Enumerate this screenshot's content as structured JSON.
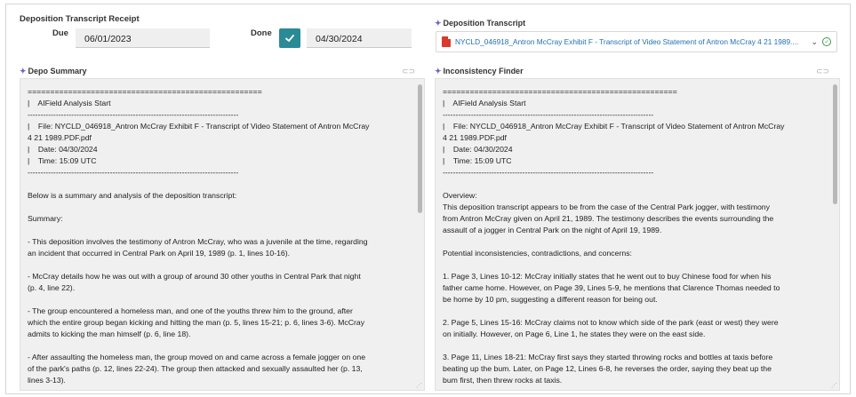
{
  "receipt": {
    "title": "Deposition Transcript Receipt",
    "due_label": "Due",
    "due_value": "06/01/2023",
    "done_label": "Done",
    "done_value": "04/30/2024"
  },
  "transcript_field": {
    "label": "Deposition Transcript",
    "file_link": "NYCLD_046918_Antron McCray Exhibit F - Transcript of Video Statement of Antron McCray 4 21 1989...."
  },
  "depo_summary": {
    "label": "Depo Summary",
    "text": "====================================================\n|    AIField Analysis Start\n----------------------------------------------------------------------------------\n|    File: NYCLD_046918_Antron McCray Exhibit F - Transcript of Video Statement of Antron McCray\n4 21 1989.PDF.pdf\n|    Date: 04/30/2024\n|    Time: 15:09 UTC\n----------------------------------------------------------------------------------\n\nBelow is a summary and analysis of the deposition transcript:\n\nSummary:\n\n- This deposition involves the testimony of Antron McCray, who was a juvenile at the time, regarding\nan incident that occurred in Central Park on April 19, 1989 (p. 1, lines 10-16).\n\n- McCray details how he was out with a group of around 30 other youths in Central Park that night\n(p. 4, line 22).\n\n- The group encountered a homeless man, and one of the youths threw him to the ground, after\nwhich the entire group began kicking and hitting the man (p. 5, lines 15-21; p. 6, lines 3-6). McCray\nadmits to kicking the man himself (p. 6, line 18).\n\n- After assaulting the homeless man, the group moved on and came across a female jogger on one\nof the park's paths (p. 12, lines 22-24). The group then attacked and sexually assaulted her (p. 13,\nlines 3-13)."
  },
  "inconsistency_finder": {
    "label": "Inconsistency Finder",
    "text": "====================================================\n|    AIField Analysis Start\n----------------------------------------------------------------------------------\n|    File: NYCLD_046918_Antron McCray Exhibit F - Transcript of Video Statement of Antron McCray\n4 21 1989.PDF.pdf\n|    Date: 04/30/2024\n|    Time: 15:09 UTC\n----------------------------------------------------------------------------------\n\nOverview:\nThis deposition transcript appears to be from the case of the Central Park jogger, with testimony\nfrom Antron McCray given on April 21, 1989. The testimony describes the events surrounding the\nassault of a jogger in Central Park on the night of April 19, 1989.\n\nPotential inconsistencies, contradictions, and concerns:\n\n1. Page 3, Lines 10-12: McCray initially states that he went out to buy Chinese food for when his\nfather came home. However, on Page 39, Lines 5-9, he mentions that Clarence Thomas needed to\nbe home by 10 pm, suggesting a different reason for being out.\n\n2. Page 5, Lines 15-16: McCray claims not to know which side of the park (east or west) they were\non initially. However, on Page 6, Line 1, he states they were on the east side.\n\n3. Page 11, Lines 18-21: McCray first says they started throwing rocks and bottles at taxis before\nbeating up the bum. Later, on Page 12, Lines 6-8, he reverses the order, saying they beat up the\nbum first, then threw rocks at taxis."
  },
  "colors": {
    "accent": "#2a8a96",
    "link": "#1f6fb5",
    "pdf": "#d93a2b",
    "ok": "#3a9a4a",
    "sparkle": "#7b5cd6"
  },
  "icons": [
    "sparkle-icon",
    "pdf-icon",
    "chevron-down-icon",
    "check-circle-icon",
    "link-icon",
    "checkmark-icon"
  ]
}
